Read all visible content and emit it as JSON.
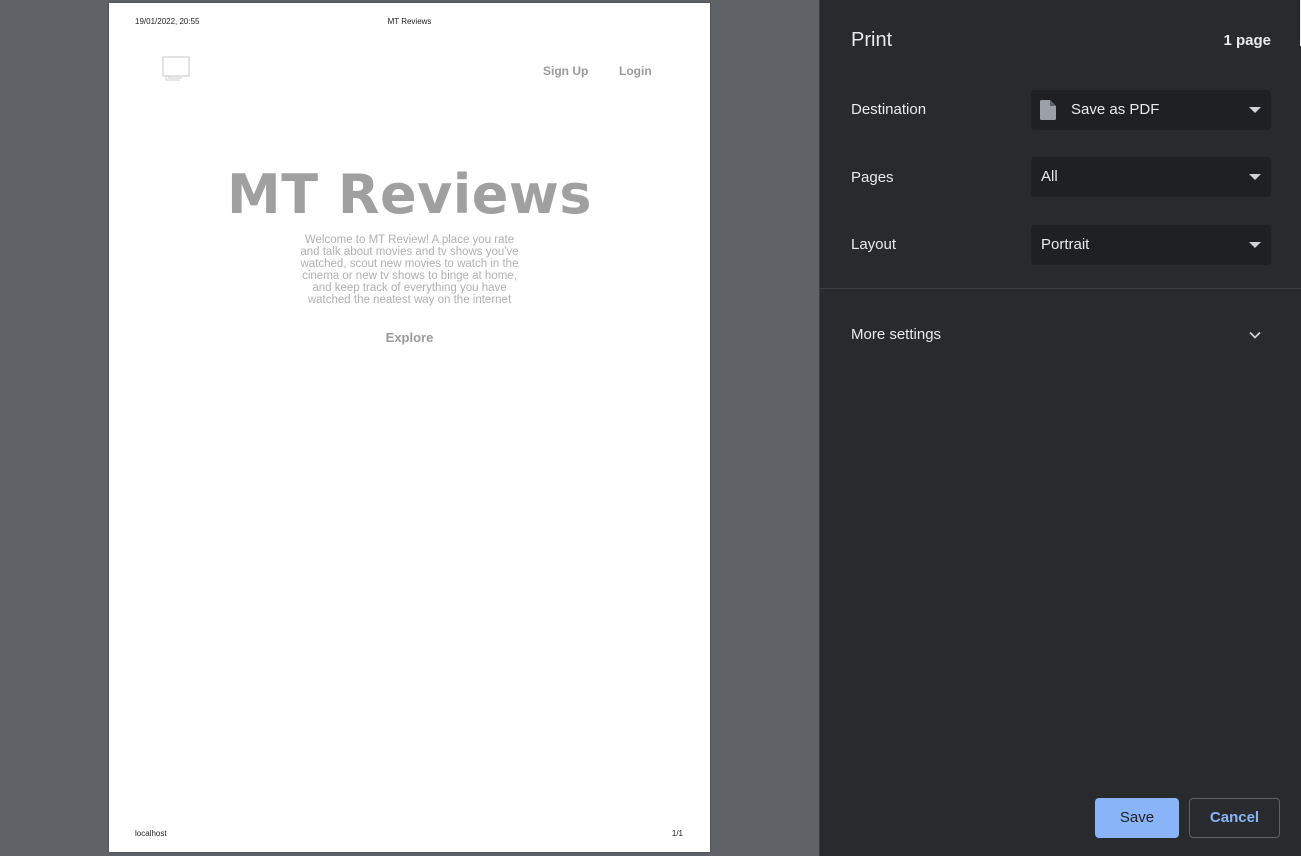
{
  "preview": {
    "header": {
      "date": "19/01/2022, 20:55",
      "title": "MT Reviews"
    },
    "footer": {
      "url": "localhost",
      "pages": "1/1"
    },
    "site": {
      "nav": {
        "signup": "Sign Up",
        "login": "Login"
      },
      "hero_title": "MT Reviews",
      "hero_text": "Welcome to MT Review! A place you rate and talk about movies and tv shows you've watched, scout new movies to watch in the cinema or new tv shows to binge at home, and keep track of everything you have watched the neatest way on the internet",
      "explore": "Explore"
    }
  },
  "panel": {
    "title": "Print",
    "page_count": "1 page",
    "destination": {
      "label": "Destination",
      "value": "Save as PDF"
    },
    "pages": {
      "label": "Pages",
      "value": "All"
    },
    "layout": {
      "label": "Layout",
      "value": "Portrait"
    },
    "more_settings": "More settings",
    "save": "Save",
    "cancel": "Cancel"
  },
  "colors": {
    "panel_bg": "#292a2d",
    "preview_bg": "#5f6368",
    "accent": "#8ab4f8"
  },
  "icons": [
    "document-icon",
    "dropdown-arrow-icon",
    "chevron-down-icon",
    "monitor-logo-icon"
  ]
}
